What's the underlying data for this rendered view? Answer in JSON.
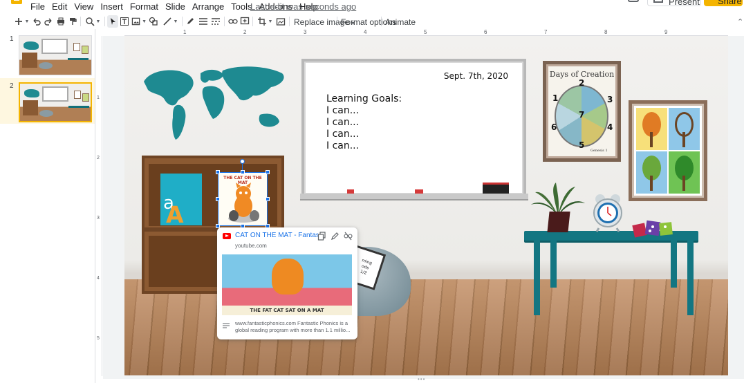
{
  "menubar": {
    "items": [
      "File",
      "Edit",
      "View",
      "Insert",
      "Format",
      "Slide",
      "Arrange",
      "Tools",
      "Add-ons",
      "Help"
    ],
    "last_edit": "Last edit was seconds ago",
    "present_label": "Present",
    "share_label": "Share"
  },
  "toolbar": {
    "replace_image": "Replace image",
    "format_options": "Format options",
    "animate": "Animate"
  },
  "ruler": {
    "top_ticks": [
      "1",
      "2",
      "3",
      "4",
      "5",
      "6",
      "7",
      "8",
      "9"
    ],
    "left_ticks": [
      "1",
      "2",
      "3",
      "4",
      "5"
    ]
  },
  "filmstrip": {
    "slides": [
      {
        "number": "1",
        "selected": false
      },
      {
        "number": "2",
        "selected": true
      }
    ]
  },
  "slide": {
    "whiteboard": {
      "date": "Sept. 7th, 2020",
      "goals_title": "Learning Goals:",
      "goal_lines": [
        "I can...",
        "I can...",
        "I can...",
        "I can..."
      ]
    },
    "days_poster": {
      "title": "Days of Creation",
      "numbers": [
        "1",
        "2",
        "3",
        "4",
        "5",
        "6",
        "7"
      ],
      "reference": "Genesis 1"
    },
    "aa_card": {
      "big": "A",
      "small": "a"
    },
    "cat_image": {
      "caption": "THE CAT ON THE MAT"
    },
    "book_text": "ming\nods\n1/2"
  },
  "link_card": {
    "title": "CAT ON THE MAT - Fantas...",
    "domain": "youtube.com",
    "preview_caption": "THE FAT CAT SAT ON A MAT",
    "description": "www.fantasticphonics.com Fantastic Phonics is a global reading program with more than 1.1 millio..."
  },
  "colors": {
    "accent": "#1a73e8",
    "brand": "#f4b400",
    "table": "#137682",
    "map": "#1e8a91"
  }
}
